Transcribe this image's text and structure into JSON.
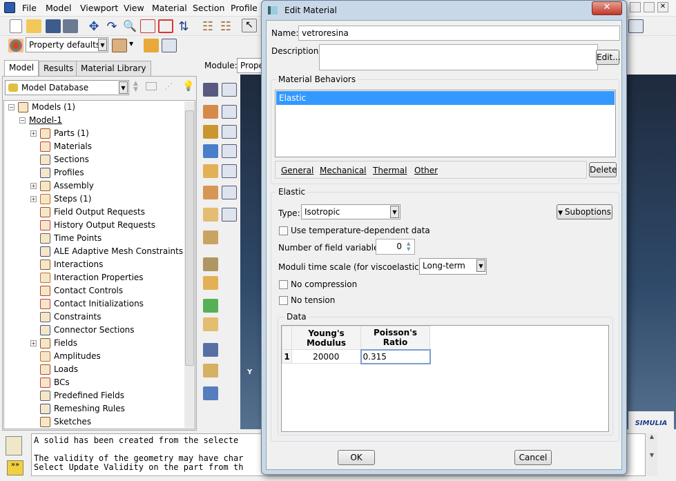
{
  "menu": [
    "File",
    "Model",
    "Viewport",
    "View",
    "Material",
    "Section",
    "Profile"
  ],
  "toolbar": {
    "render_style": "Property defaults"
  },
  "tabs": [
    "Model",
    "Results",
    "Material Library"
  ],
  "model_db": "Model Database",
  "module": {
    "label": "Module:",
    "value": "Prope"
  },
  "tree": [
    {
      "label": "Models (1)",
      "level": 0,
      "exp": "-"
    },
    {
      "label": "Model-1",
      "level": 1,
      "exp": "-"
    },
    {
      "label": "Parts (1)",
      "level": 2,
      "exp": "+"
    },
    {
      "label": "Materials",
      "level": 2
    },
    {
      "label": "Sections",
      "level": 2
    },
    {
      "label": "Profiles",
      "level": 2
    },
    {
      "label": "Assembly",
      "level": 2,
      "exp": "+"
    },
    {
      "label": "Steps (1)",
      "level": 2,
      "exp": "+"
    },
    {
      "label": "Field Output Requests",
      "level": 2
    },
    {
      "label": "History Output Requests",
      "level": 2
    },
    {
      "label": "Time Points",
      "level": 2
    },
    {
      "label": "ALE Adaptive Mesh Constraints",
      "level": 2
    },
    {
      "label": "Interactions",
      "level": 2
    },
    {
      "label": "Interaction Properties",
      "level": 2
    },
    {
      "label": "Contact Controls",
      "level": 2
    },
    {
      "label": "Contact Initializations",
      "level": 2
    },
    {
      "label": "Constraints",
      "level": 2
    },
    {
      "label": "Connector Sections",
      "level": 2
    },
    {
      "label": "Fields",
      "level": 2,
      "exp": "+"
    },
    {
      "label": "Amplitudes",
      "level": 2
    },
    {
      "label": "Loads",
      "level": 2
    },
    {
      "label": "BCs",
      "level": 2
    },
    {
      "label": "Predefined Fields",
      "level": 2
    },
    {
      "label": "Remeshing Rules",
      "level": 2
    },
    {
      "label": "Sketches",
      "level": 2
    }
  ],
  "messages": [
    "A solid has been created from the selecte",
    "",
    "The validity of the geometry may have char",
    "Select Update Validity on the part from th"
  ],
  "viewport": {
    "axis_label": "Y",
    "logo": "SIMULIA"
  },
  "dialog": {
    "title": "Edit Material",
    "name_label": "Name:",
    "name_value": "vetroresina",
    "desc_label": "Description:",
    "desc_value": "",
    "edit_btn": "Edit...",
    "behaviors_label": "Material Behaviors",
    "behaviors": [
      "Elastic"
    ],
    "menus": [
      "General",
      "Mechanical",
      "Thermal",
      "Other"
    ],
    "delete_btn": "Delete",
    "elastic_label": "Elastic",
    "type_label": "Type:",
    "type_value": "Isotropic",
    "suboptions_btn": "Suboptions",
    "temp_dep_label": "Use temperature-dependent data",
    "temp_dep": false,
    "field_vars_label": "Number of field variables:",
    "field_vars": "0",
    "moduli_label": "Moduli time scale (for viscoelasticity):",
    "moduli_value": "Long-term",
    "no_compression_label": "No compression",
    "no_compression": false,
    "no_tension_label": "No tension",
    "no_tension": false,
    "data_label": "Data",
    "columns": [
      "Young's\nModulus",
      "Poisson's\nRatio"
    ],
    "rows": [
      {
        "index": "1",
        "E": "20000",
        "nu": "0.315"
      }
    ],
    "ok_btn": "OK",
    "cancel_btn": "Cancel",
    "accent": "#3399ff"
  }
}
